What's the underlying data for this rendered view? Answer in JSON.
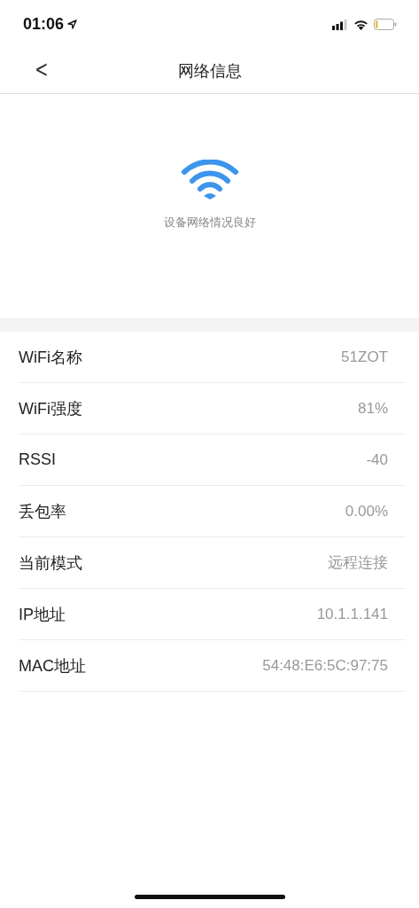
{
  "status_bar": {
    "time": "01:06"
  },
  "nav": {
    "back": "<",
    "title": "网络信息"
  },
  "status": {
    "message": "设备网络情况良好"
  },
  "rows": [
    {
      "label": "WiFi名称",
      "value": "51ZOT"
    },
    {
      "label": "WiFi强度",
      "value": "81%"
    },
    {
      "label": "RSSI",
      "value": "-40"
    },
    {
      "label": "丢包率",
      "value": "0.00%"
    },
    {
      "label": "当前模式",
      "value": "远程连接"
    },
    {
      "label": "IP地址",
      "value": "10.1.1.141"
    },
    {
      "label": "MAC地址",
      "value": "54:48:E6:5C:97:75"
    }
  ]
}
